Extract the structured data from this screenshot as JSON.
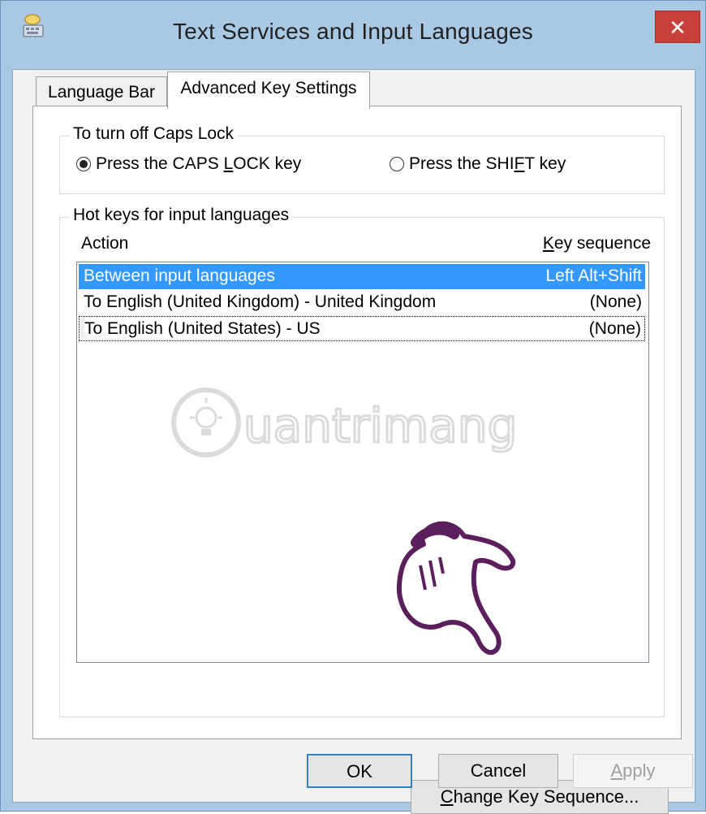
{
  "window": {
    "title": "Text Services and Input Languages",
    "close_glyph": "✕",
    "icon": "keyboard-language-icon"
  },
  "tabs": [
    {
      "label": "Language Bar",
      "selected": false
    },
    {
      "label": "Advanced Key Settings",
      "selected": true
    }
  ],
  "caps_group": {
    "legend": "To turn off Caps Lock",
    "option1": {
      "pre": "Press the CAPS ",
      "mnemonic": "L",
      "post": "OCK key",
      "checked": true
    },
    "option2": {
      "pre": "Press the SHI",
      "mnemonic": "F",
      "post": "T key",
      "checked": false
    }
  },
  "hotkeys_group": {
    "legend": "Hot keys for input languages",
    "col_action": "Action",
    "col_key_mnemonic": "K",
    "col_key_rest": "ey sequence",
    "rows": [
      {
        "action": "Between input languages",
        "sequence": "Left Alt+Shift",
        "selected": true
      },
      {
        "action": "To English (United Kingdom) - United Kingdom",
        "sequence": "(None)",
        "selected": false
      },
      {
        "action": "To English (United States) - US",
        "sequence": "(None)",
        "selected": false,
        "focused": true
      }
    ],
    "change_button": {
      "mnemonic": "C",
      "rest": "hange Key Sequence..."
    }
  },
  "footer": {
    "ok": "OK",
    "cancel": "Cancel",
    "apply_mnemonic": "A",
    "apply_rest": "pply"
  },
  "watermark": {
    "text": "uantrimang"
  },
  "colors": {
    "selection": "#3399ff",
    "close": "#c7403a",
    "frame": "#a8c8e3"
  }
}
